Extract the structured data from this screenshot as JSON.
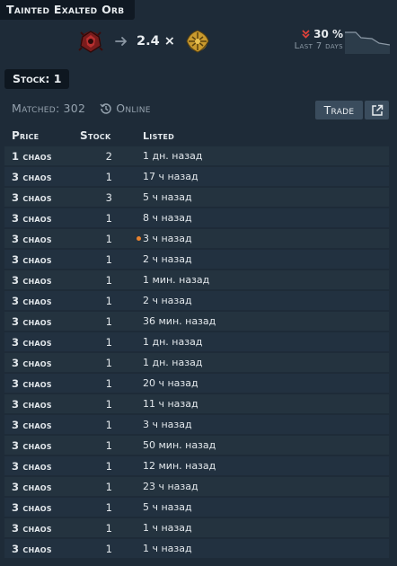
{
  "title": "Tainted Exalted Orb",
  "rate": {
    "value": "2.4 ×",
    "from_icon": "tainted-exalted-orb-icon",
    "to_icon": "chaos-orb-icon"
  },
  "change": {
    "percent": "30 %",
    "direction": "down",
    "label": "Last 7 days"
  },
  "stock_pill": "Stock: 1",
  "matched": {
    "label": "Matched:",
    "count": "302",
    "status": "Online"
  },
  "buttons": {
    "trade": "Trade"
  },
  "table": {
    "headers": {
      "price": "Price",
      "stock": "Stock",
      "listed": "Listed"
    },
    "rows": [
      {
        "price": "1 chaos",
        "stock": "2",
        "listed": "1 дн. назад",
        "dot": false
      },
      {
        "price": "3 chaos",
        "stock": "1",
        "listed": "17 ч назад",
        "dot": false
      },
      {
        "price": "3 chaos",
        "stock": "3",
        "listed": "5 ч назад",
        "dot": false
      },
      {
        "price": "3 chaos",
        "stock": "1",
        "listed": "8 ч назад",
        "dot": false
      },
      {
        "price": "3 chaos",
        "stock": "1",
        "listed": "3 ч назад",
        "dot": true
      },
      {
        "price": "3 chaos",
        "stock": "1",
        "listed": "2 ч назад",
        "dot": false
      },
      {
        "price": "3 chaos",
        "stock": "1",
        "listed": "1 мин. назад",
        "dot": false
      },
      {
        "price": "3 chaos",
        "stock": "1",
        "listed": "2 ч назад",
        "dot": false
      },
      {
        "price": "3 chaos",
        "stock": "1",
        "listed": "36 мин. назад",
        "dot": false
      },
      {
        "price": "3 chaos",
        "stock": "1",
        "listed": "1 дн. назад",
        "dot": false
      },
      {
        "price": "3 chaos",
        "stock": "1",
        "listed": "1 дн. назад",
        "dot": false
      },
      {
        "price": "3 chaos",
        "stock": "1",
        "listed": "20 ч назад",
        "dot": false
      },
      {
        "price": "3 chaos",
        "stock": "1",
        "listed": "11 ч назад",
        "dot": false
      },
      {
        "price": "3 chaos",
        "stock": "1",
        "listed": "3 ч назад",
        "dot": false
      },
      {
        "price": "3 chaos",
        "stock": "1",
        "listed": "50 мин. назад",
        "dot": false
      },
      {
        "price": "3 chaos",
        "stock": "1",
        "listed": "12 мин. назад",
        "dot": false
      },
      {
        "price": "3 chaos",
        "stock": "1",
        "listed": "23 ч назад",
        "dot": false
      },
      {
        "price": "3 chaos",
        "stock": "1",
        "listed": "5 ч назад",
        "dot": false
      },
      {
        "price": "3 chaos",
        "stock": "1",
        "listed": "1 ч назад",
        "dot": false
      },
      {
        "price": "3 chaos",
        "stock": "1",
        "listed": "1 ч назад",
        "dot": false
      }
    ]
  },
  "colors": {
    "background": "#1e2b38",
    "down_indicator": "#e0413a",
    "online_dot": "#e9822e"
  }
}
